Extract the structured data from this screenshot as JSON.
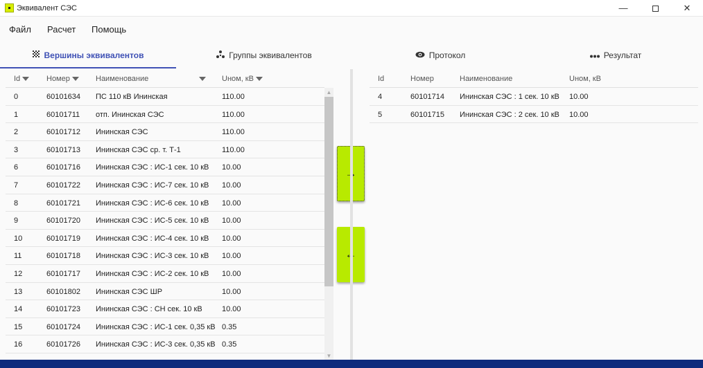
{
  "window": {
    "title": "Эквивалент СЭС"
  },
  "menu": [
    "Файл",
    "Расчет",
    "Помощь"
  ],
  "tabs": [
    {
      "label": "Вершины эквивалентов",
      "icon": "checkerboard-icon"
    },
    {
      "label": "Группы эквивалентов",
      "icon": "group-icon"
    },
    {
      "label": "Протокол",
      "icon": "eye-icon"
    },
    {
      "label": "Результат",
      "icon": "dots-icon"
    }
  ],
  "left_table": {
    "headers": [
      "Id",
      "Номер",
      "Наименование",
      "Uном, кВ"
    ],
    "rows": [
      [
        "0",
        "60101634",
        "ПС 110 кВ Ининская",
        "110.00"
      ],
      [
        "1",
        "60101711",
        "отп. Ининская СЭС",
        "110.00"
      ],
      [
        "2",
        "60101712",
        "Ининская СЭС",
        "110.00"
      ],
      [
        "3",
        "60101713",
        "Ининская СЭС ср. т. Т-1",
        "110.00"
      ],
      [
        "6",
        "60101716",
        "Ининская СЭС : ИС-1 сек. 10 кВ",
        "10.00"
      ],
      [
        "7",
        "60101722",
        "Ининская СЭС : ИС-7 сек. 10 кВ",
        "10.00"
      ],
      [
        "8",
        "60101721",
        "Ининская СЭС : ИС-6 сек. 10 кВ",
        "10.00"
      ],
      [
        "9",
        "60101720",
        "Ининская СЭС : ИС-5 сек. 10 кВ",
        "10.00"
      ],
      [
        "10",
        "60101719",
        "Ининская СЭС : ИС-4 сек. 10 кВ",
        "10.00"
      ],
      [
        "11",
        "60101718",
        "Ининская СЭС : ИС-3 сек. 10 кВ",
        "10.00"
      ],
      [
        "12",
        "60101717",
        "Ининская СЭС : ИС-2 сек. 10 кВ",
        "10.00"
      ],
      [
        "13",
        "60101802",
        "Ининская СЭС ШР",
        "10.00"
      ],
      [
        "14",
        "60101723",
        "Ининская СЭС : СН сек. 10 кВ",
        "10.00"
      ],
      [
        "15",
        "60101724",
        "Ининская СЭС : ИС-1 сек. 0,35 кВ",
        "0.35"
      ],
      [
        "16",
        "60101726",
        "Ининская СЭС : ИС-3 сек. 0,35 кВ",
        "0.35"
      ]
    ]
  },
  "right_table": {
    "headers": [
      "Id",
      "Номер",
      "Наименование",
      "Uном, кВ"
    ],
    "rows": [
      [
        "4",
        "60101714",
        "Ининская СЭС : 1 сек. 10 кВ",
        "10.00"
      ],
      [
        "5",
        "60101715",
        "Ининская СЭС : 2 сек. 10 кВ",
        "10.00"
      ]
    ]
  },
  "buttons": {
    "move_right": "→",
    "move_left": "←"
  },
  "colors": {
    "accent": "#3f51b5",
    "button": "#b8ea00",
    "statusbar": "#0d2a7c"
  }
}
